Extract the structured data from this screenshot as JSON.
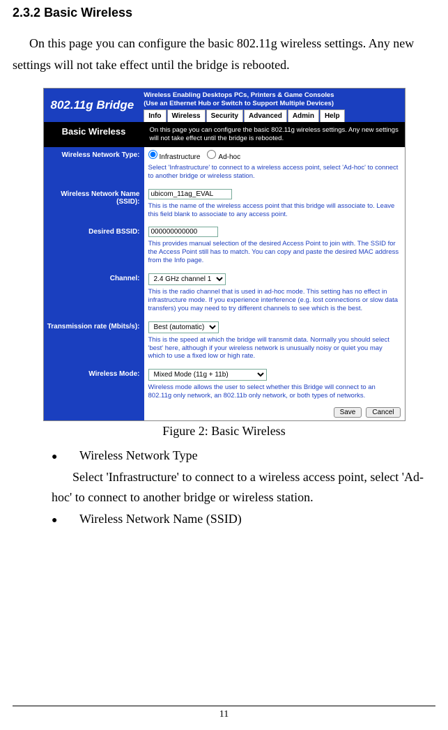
{
  "section": {
    "number": "2.3.2",
    "title": "Basic Wireless",
    "intro": "On this page you can configure the basic 802.11g wireless settings. Any new settings will not take effect until the bridge is rebooted."
  },
  "panel": {
    "brand_title": "802.11g Bridge",
    "tagline_line1": "Wireless Enabling Desktops PCs, Printers & Game Consoles",
    "tagline_line2": "(Use an Ethernet Hub or Switch to Support Multiple Devices)",
    "tabs": [
      "Info",
      "Wireless",
      "Security",
      "Advanced",
      "Admin",
      "Help"
    ],
    "page_label": "Basic Wireless",
    "page_desc": "On this page you can configure the basic 802.11g wireless settings. Any new settings will not take effect until the bridge is rebooted.",
    "fields": {
      "network_type": {
        "label": "Wireless Network Type:",
        "option_infra": "Infrastructure",
        "option_adhoc": "Ad-hoc",
        "selected": "Infrastructure",
        "help": "Select 'Infrastructure' to connect to a wireless access point, select 'Ad-hoc' to connect to another bridge or wireless station."
      },
      "ssid": {
        "label": "Wireless Network Name (SSID):",
        "value": "ubicom_11ag_EVAL",
        "help": "This is the name of the wireless access point that this bridge will associate to. Leave this field blank to associate to any access point."
      },
      "bssid": {
        "label": "Desired BSSID:",
        "value": "000000000000",
        "help": "This provides manual selection of the desired Access Point to join with. The SSID for the Access Point still has to match. You can copy and paste the desired MAC address from the Info page."
      },
      "channel": {
        "label": "Channel:",
        "value": "2.4 GHz channel 1",
        "help": "This is the radio channel that is used in ad-hoc mode. This setting has no effect in infrastructure mode. If you experience interference (e.g. lost connections or slow data transfers) you may need to try different channels to see which is the best."
      },
      "tx_rate": {
        "label": "Transmission rate (Mbits/s):",
        "value": "Best (automatic)",
        "help": "This is the speed at which the bridge will transmit data. Normally you should select 'best' here, although if your wireless network is unusually noisy or quiet you may which to use a fixed low or high rate."
      },
      "wireless_mode": {
        "label": "Wireless Mode:",
        "value": "Mixed Mode (11g + 11b)",
        "help": "Wireless mode allows the user to select whether this Bridge will connect to an 802.11g only network, an 802.11b only network, or both types of networks."
      }
    },
    "buttons": {
      "save": "Save",
      "cancel": "Cancel"
    }
  },
  "caption": "Figure 2: Basic Wireless",
  "bullets": {
    "b1_title": "Wireless Network Type",
    "b1_body": "Select 'Infrastructure' to connect to a wireless access point, select 'Ad-hoc' to connect to another bridge or wireless station.",
    "b2_title": "Wireless Network Name (SSID)"
  },
  "page_number": "11"
}
